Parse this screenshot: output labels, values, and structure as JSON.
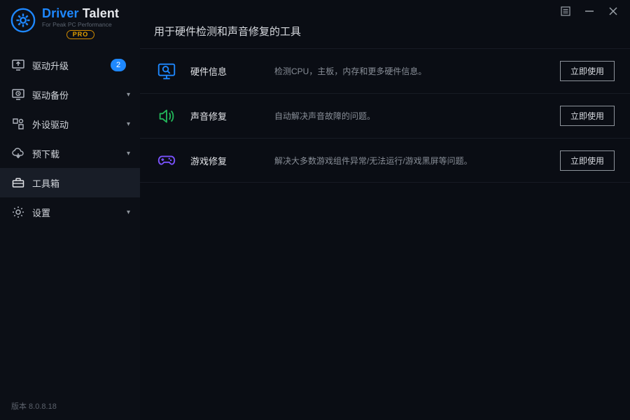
{
  "app": {
    "logo_main_blue": "Driver",
    "logo_main_white": "Talent",
    "logo_subtitle": "For Peak PC Performance",
    "logo_badge": "PRO"
  },
  "sidebar": {
    "items": [
      {
        "label": "驱动升级",
        "badge": "2",
        "expandable": false
      },
      {
        "label": "驱动备份",
        "expandable": true
      },
      {
        "label": "外设驱动",
        "expandable": true
      },
      {
        "label": "预下载",
        "expandable": true
      },
      {
        "label": "工具箱",
        "expandable": false,
        "active": true
      },
      {
        "label": "设置",
        "expandable": true
      }
    ]
  },
  "main": {
    "title": "用于硬件检测和声音修复的工具",
    "tools": [
      {
        "name": "硬件信息",
        "desc": "检测CPU，主板，内存和更多硬件信息。",
        "action": "立即使用"
      },
      {
        "name": "声音修复",
        "desc": "自动解决声音故障的问题。",
        "action": "立即使用"
      },
      {
        "name": "游戏修复",
        "desc": "解决大多数游戏组件异常/无法运行/游戏黑屏等问题。",
        "action": "立即使用"
      }
    ]
  },
  "footer": {
    "version": "版本 8.0.8.18"
  }
}
